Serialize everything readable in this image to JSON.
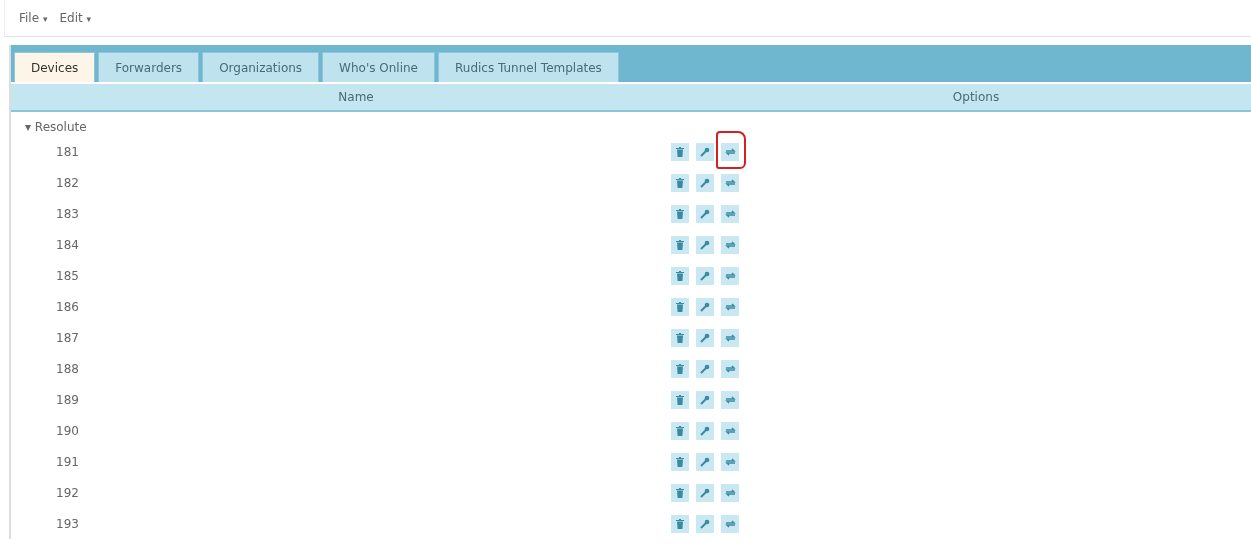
{
  "menu": [
    {
      "label": "File",
      "caret": "▾"
    },
    {
      "label": "Edit",
      "caret": "▾"
    }
  ],
  "tabs": [
    {
      "label": "Devices",
      "selected": true
    },
    {
      "label": "Forwarders",
      "selected": false
    },
    {
      "label": "Organizations",
      "selected": false
    },
    {
      "label": "Who's Online",
      "selected": false
    },
    {
      "label": "Rudics Tunnel Templates",
      "selected": false
    }
  ],
  "table": {
    "columns": [
      "Name",
      "Options"
    ],
    "groups": [
      {
        "name": "Resolute",
        "toggle": "▾",
        "expanded": true,
        "rows": [
          {
            "name": "181",
            "circled": true
          },
          {
            "name": "182",
            "circled": false
          },
          {
            "name": "183",
            "circled": false
          },
          {
            "name": "184",
            "circled": false
          },
          {
            "name": "185",
            "circled": false
          },
          {
            "name": "186",
            "circled": false
          },
          {
            "name": "187",
            "circled": false
          },
          {
            "name": "188",
            "circled": false
          },
          {
            "name": "189",
            "circled": false
          },
          {
            "name": "190",
            "circled": false
          },
          {
            "name": "191",
            "circled": false
          },
          {
            "name": "192",
            "circled": false
          },
          {
            "name": "193",
            "circled": false
          }
        ]
      }
    ]
  }
}
